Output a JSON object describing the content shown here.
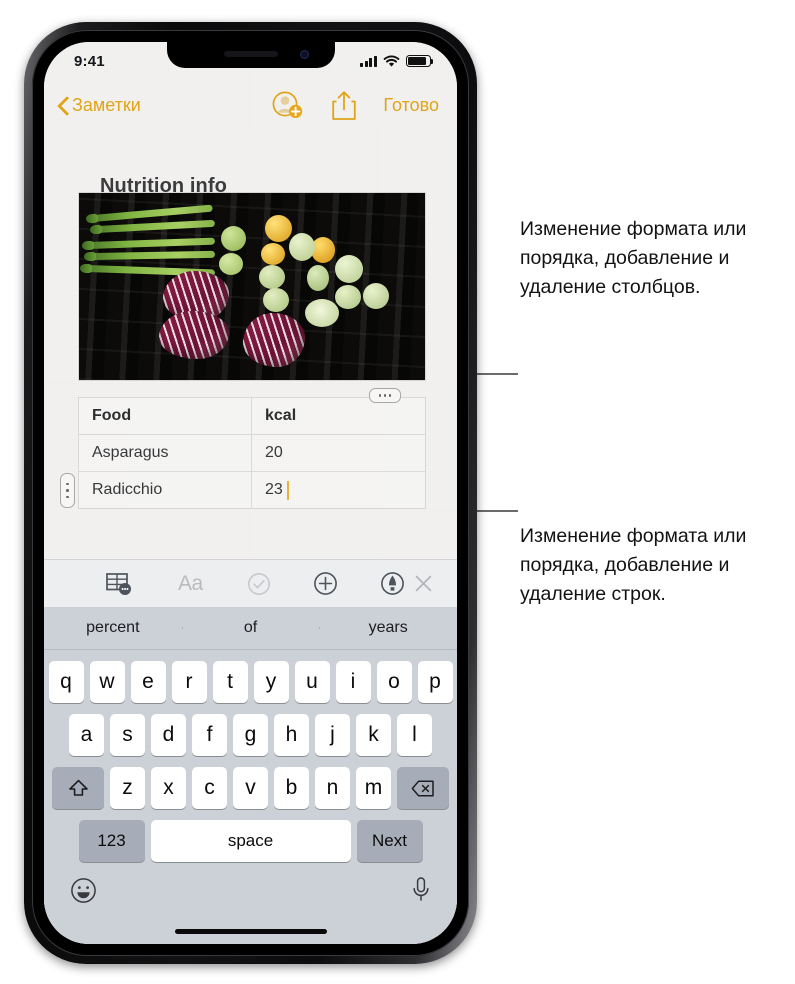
{
  "status_bar": {
    "time": "9:41",
    "signal_icon": "cellular-bars-icon",
    "wifi_icon": "wifi-icon",
    "battery_icon": "battery-icon"
  },
  "nav_bar": {
    "back_label": "Заметки",
    "back_icon": "chevron-left-icon",
    "add_people_icon": "add-person-icon",
    "share_icon": "share-icon",
    "done_label": "Готово"
  },
  "note": {
    "title": "Nutrition info",
    "photo_alt": "grilled-vegetables-photo"
  },
  "table": {
    "columns": [
      "Food",
      "kcal"
    ],
    "rows": [
      [
        "Asparagus",
        "20"
      ],
      [
        "Radicchio",
        "23"
      ]
    ],
    "column_handle_icon": "column-handle-dots-icon",
    "row_handle_icon": "row-handle-dots-icon",
    "caret": ""
  },
  "format_toolbar": {
    "table_icon": "table-options-icon",
    "text_style_label": "Aa",
    "checklist_icon": "checklist-icon",
    "add_icon": "plus-circle-icon",
    "markup_icon": "markup-pen-icon",
    "close_icon": "close-x-icon"
  },
  "keyboard": {
    "predictions": [
      "percent",
      "of",
      "years"
    ],
    "row1": [
      "q",
      "w",
      "e",
      "r",
      "t",
      "y",
      "u",
      "i",
      "o",
      "p"
    ],
    "row2": [
      "a",
      "s",
      "d",
      "f",
      "g",
      "h",
      "j",
      "k",
      "l"
    ],
    "row3": [
      "z",
      "x",
      "c",
      "v",
      "b",
      "n",
      "m"
    ],
    "shift_icon": "shift-arrow-icon",
    "backspace_icon": "backspace-icon",
    "numbers_label": "123",
    "space_label": "space",
    "next_label": "Next",
    "emoji_icon": "emoji-smiley-icon",
    "dictation_icon": "microphone-icon"
  },
  "callouts": {
    "columns": "Изменение формата или порядка, добавление и удаление столбцов.",
    "rows": "Изменение формата или порядка, добавление и удаление строк."
  },
  "colors": {
    "accent": "#e0a418",
    "caret": "#e8b13a",
    "keyboard_bg": "#ccd0d7"
  }
}
